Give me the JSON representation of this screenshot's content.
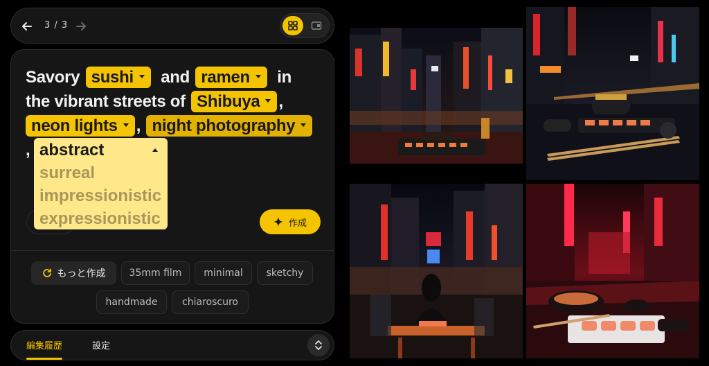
{
  "nav": {
    "page_indicator": "3 / 3"
  },
  "prompt": {
    "t1": "Savory",
    "chip_sushi": "sushi",
    "t2": "and",
    "chip_ramen": "ramen",
    "t3": "in",
    "t4": "the vibrant streets of",
    "chip_shibuya": "Shibuya",
    "t5": ",",
    "chip_neon": "neon lights",
    "t6": ",",
    "chip_night": "night photography",
    "t7": ","
  },
  "dropdown": {
    "selected": "abstract",
    "options": [
      "surreal",
      "impressionistic",
      "expressionistic"
    ]
  },
  "create_label": "作成",
  "suggestions": {
    "more": "もっと作成",
    "items": [
      "35mm film",
      "minimal",
      "sketchy",
      "handmade",
      "chiaroscuro"
    ]
  },
  "tabs": {
    "history": "編集履歴",
    "settings": "設定"
  },
  "colors": {
    "accent": "#f5c400",
    "panel": "#161616",
    "dropdown_bg": "#ffe88a"
  }
}
